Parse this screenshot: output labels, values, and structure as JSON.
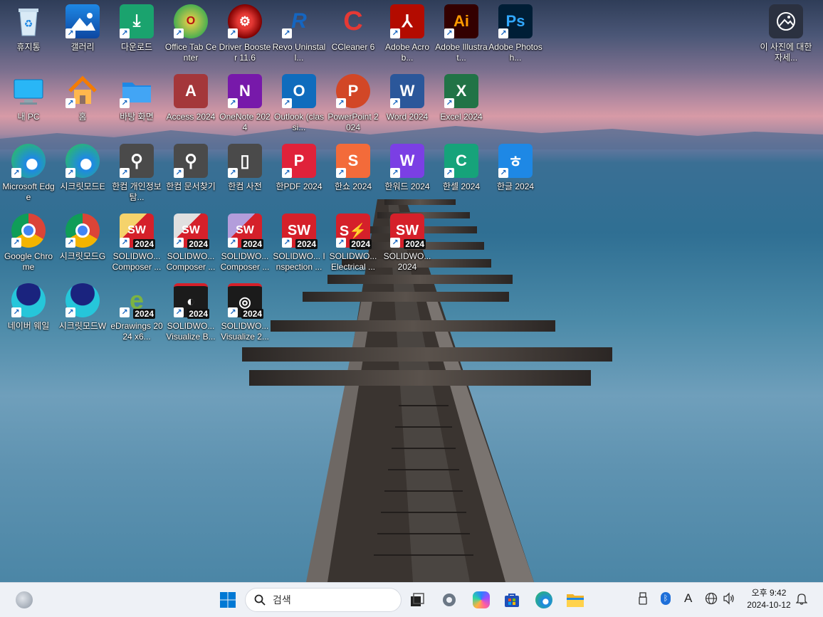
{
  "desktop": {
    "icons": [
      {
        "label": "휴지통",
        "icon": "recycle-bin-icon"
      },
      {
        "label": "갤러리",
        "icon": "gallery-icon"
      },
      {
        "label": "다운로드",
        "icon": "downloads-folder-icon"
      },
      {
        "label": "Office Tab Center",
        "icon": "office-tab-icon"
      },
      {
        "label": "Driver Booster 11.6",
        "icon": "driver-booster-icon"
      },
      {
        "label": "Revo Uninstall...",
        "icon": "revo-uninstaller-icon"
      },
      {
        "label": "CCleaner 6",
        "icon": "ccleaner-icon"
      },
      {
        "label": "Adobe Acrob...",
        "icon": "adobe-acrobat-icon"
      },
      {
        "label": "Adobe Illustrat...",
        "icon": "adobe-illustrator-icon"
      },
      {
        "label": "Adobe Photosh...",
        "icon": "adobe-photoshop-icon"
      },
      {
        "label": "내 PC",
        "icon": "this-pc-icon"
      },
      {
        "label": "홈",
        "icon": "home-icon"
      },
      {
        "label": "바탕 화면",
        "icon": "desktop-folder-icon"
      },
      {
        "label": "Access 2024",
        "icon": "access-icon"
      },
      {
        "label": "OneNote 2024",
        "icon": "onenote-icon"
      },
      {
        "label": "Outlook (classi...",
        "icon": "outlook-icon"
      },
      {
        "label": "PowerPoint 2024",
        "icon": "powerpoint-icon"
      },
      {
        "label": "Word 2024",
        "icon": "word-icon"
      },
      {
        "label": "Excel 2024",
        "icon": "excel-icon"
      },
      {
        "label": "Microsoft Edge",
        "icon": "edge-icon"
      },
      {
        "label": "시크릿모드E",
        "icon": "edge-icon"
      },
      {
        "label": "한컴 개인정보탐...",
        "icon": "hancom-privacy-icon"
      },
      {
        "label": "한컴 문서찾기",
        "icon": "hancom-search-icon"
      },
      {
        "label": "한컴 사전",
        "icon": "hancom-dictionary-icon"
      },
      {
        "label": "한PDF 2024",
        "icon": "hanpdf-icon"
      },
      {
        "label": "한쇼 2024",
        "icon": "hanshow-icon"
      },
      {
        "label": "한워드 2024",
        "icon": "hanword-icon"
      },
      {
        "label": "한셀 2024",
        "icon": "hancell-icon"
      },
      {
        "label": "한글 2024",
        "icon": "hangul-icon"
      },
      {
        "label": "Google Chrome",
        "icon": "chrome-icon"
      },
      {
        "label": "시크릿모드G",
        "icon": "chrome-icon"
      },
      {
        "label": "SOLIDWO... Composer ...",
        "icon": "solidworks-composer-icon"
      },
      {
        "label": "SOLIDWO... Composer ...",
        "icon": "solidworks-composer-icon"
      },
      {
        "label": "SOLIDWO... Composer ...",
        "icon": "solidworks-composer-icon"
      },
      {
        "label": "SOLIDWO... Inspection ...",
        "icon": "solidworks-inspection-icon"
      },
      {
        "label": "SOLIDWO... Electrical ...",
        "icon": "solidworks-electrical-icon"
      },
      {
        "label": "SOLIDWO... 2024",
        "icon": "solidworks-icon"
      },
      {
        "label": "네이버 웨일",
        "icon": "whale-icon"
      },
      {
        "label": "시크릿모드W",
        "icon": "whale-icon"
      },
      {
        "label": "eDrawings 2024 x6...",
        "icon": "edrawings-icon"
      },
      {
        "label": "SOLIDWO... Visualize B...",
        "icon": "solidworks-visualize-icon"
      },
      {
        "label": "SOLIDWO... Visualize 2...",
        "icon": "solidworks-visualize-icon"
      }
    ],
    "spotlight": {
      "label": "이 사진에 대한 자세...",
      "icon": "spotlight-info-icon"
    },
    "badge_year": "2024"
  },
  "taskbar": {
    "search_label": "검색",
    "items": [
      {
        "icon": "widgets-icon"
      },
      {
        "icon": "windows-start-icon"
      },
      {
        "icon": "task-view-icon"
      },
      {
        "icon": "settings-icon"
      },
      {
        "icon": "copilot-icon"
      },
      {
        "icon": "microsoft-store-icon"
      },
      {
        "icon": "edge-icon"
      },
      {
        "icon": "file-explorer-icon"
      }
    ],
    "tray": {
      "ime_label": "A",
      "time": "오후 9:42",
      "date": "2024-10-12"
    }
  },
  "colors": {
    "word": "#2b579a",
    "excel": "#217346",
    "powerpoint": "#d24726",
    "outlook": "#0f6cbd",
    "onenote": "#7719aa",
    "access": "#a4373a",
    "acrobat": "#b30b00",
    "illustrator": "#330000",
    "photoshop": "#001e36",
    "solidworks": "#d5202a"
  }
}
